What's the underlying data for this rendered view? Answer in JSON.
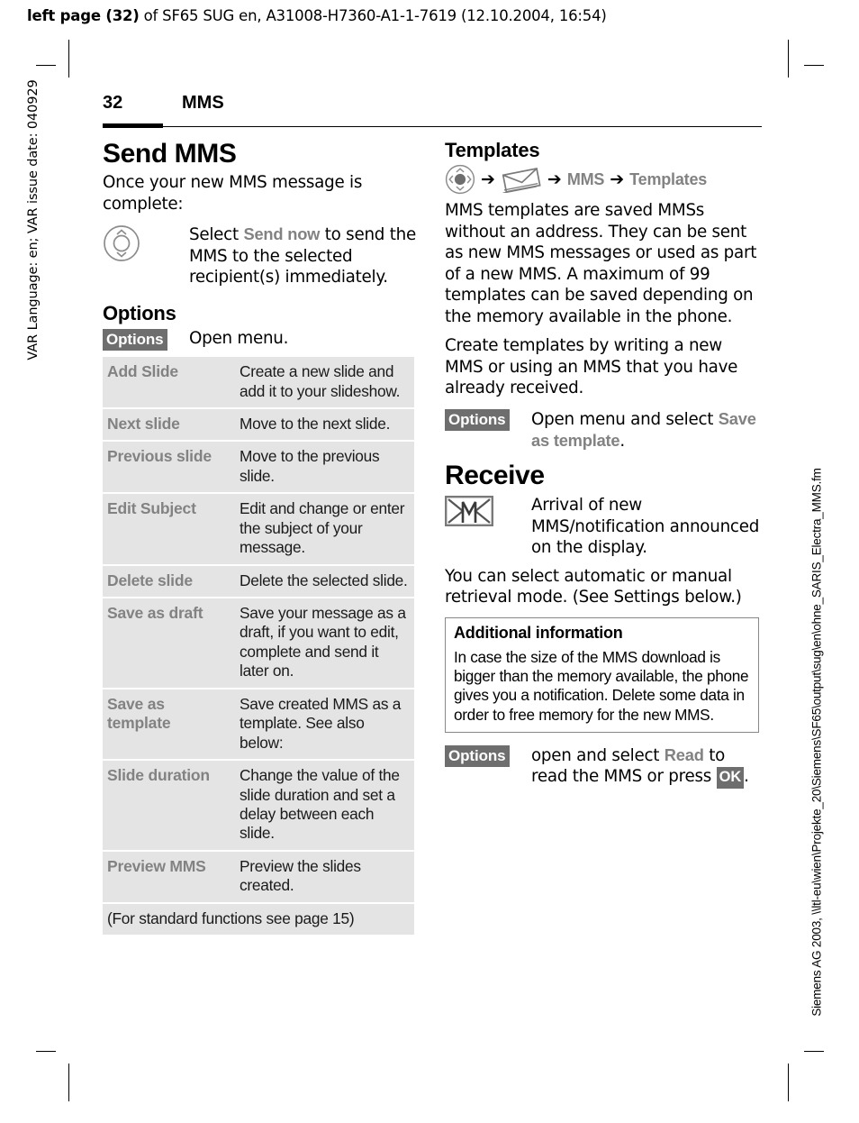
{
  "running_head": {
    "bold_prefix": "left page (32)",
    "rest": " of SF65 SUG en, A31008-H7360-A1-1-7619 (12.10.2004, 16:54)"
  },
  "side_left": "VAR Language: en; VAR issue date: 040929",
  "side_right": "Siemens AG 2003, \\\\ltl-eu\\wien\\Projekte_20\\Siemens\\SF65\\output\\sug\\en\\ohne_SARIS_Electra_MMS.fm",
  "header": {
    "page_number": "32",
    "section": "MMS"
  },
  "left_column": {
    "chapter_title": "Send MMS",
    "intro": "Once your new MMS message is complete:",
    "nav_key_row": {
      "icon": "navigation-key-icon",
      "text_before": "Select ",
      "menu_name": "Send now",
      "text_after": " to send the MMS to the selected recipient(s) immediately."
    },
    "options_heading": "Options",
    "options_softkey": {
      "label": "Options",
      "description": "Open menu."
    },
    "options_table": {
      "rows": [
        {
          "label": "Add Slide",
          "desc": "Create a new slide and add it to your slideshow."
        },
        {
          "label": "Next slide",
          "desc": "Move to the next slide."
        },
        {
          "label": "Previous slide",
          "desc": "Move to the previous slide."
        },
        {
          "label": "Edit Subject",
          "desc": "Edit and change or enter the subject of your message."
        },
        {
          "label": "Delete slide",
          "desc": "Delete the selected slide."
        },
        {
          "label": "Save as draft",
          "desc": "Save your message as a draft, if you want to edit, complete and send it later on."
        },
        {
          "label": "Save as template",
          "desc": "Save created MMS as a template. See also below:"
        },
        {
          "label": "Slide duration",
          "desc": "Change the value of the slide duration and set a delay between each slide."
        },
        {
          "label": "Preview MMS",
          "desc": "Preview the slides created."
        }
      ],
      "footnote": "(For standard functions see page 15)"
    }
  },
  "right_column": {
    "templates_heading": "Templates",
    "breadcrumb": {
      "nav_icon": "navigation-key-icon",
      "arrow1": "➔",
      "envelope_icon": "envelope-icon",
      "arrow2": "➔",
      "item1": "MMS",
      "arrow3": "➔",
      "item2": "Templates"
    },
    "para1": "MMS templates are saved MMSs without an address. They can be sent as new MMS messages or used as part of a new MMS. A maximum of 99 templates can be saved depending on the memory available in the phone.",
    "para2": "Create templates by writing a new MMS or using an MMS that you have already received.",
    "save_template_row": {
      "softkey": "Options",
      "text_before": "Open menu and select ",
      "menu_name": "Save as template",
      "text_after": "."
    },
    "receive_heading": "Receive",
    "receive_row": {
      "icon": "new-mms-notification-icon",
      "text": "Arrival of new MMS/notification announced on the display."
    },
    "para3": "You can select automatic or manual retrieval mode. (See Settings below.)",
    "infobox": {
      "title": "Additional information",
      "body": "In case the size of the MMS download is bigger than the memory available, the phone gives you a notification. Delete some data in order to free memory for the new MMS."
    },
    "read_row": {
      "softkey": "Options",
      "text_before": "open and select ",
      "menu_name": "Read",
      "text_middle": " to read the MMS or press ",
      "ok_key": "OK",
      "text_after": "."
    }
  },
  "colors": {
    "softkey_bg": "#6e6e6e",
    "table_row_bg": "#e4e4e4",
    "menu_name": "#828282",
    "infobox_border": "#888888"
  }
}
